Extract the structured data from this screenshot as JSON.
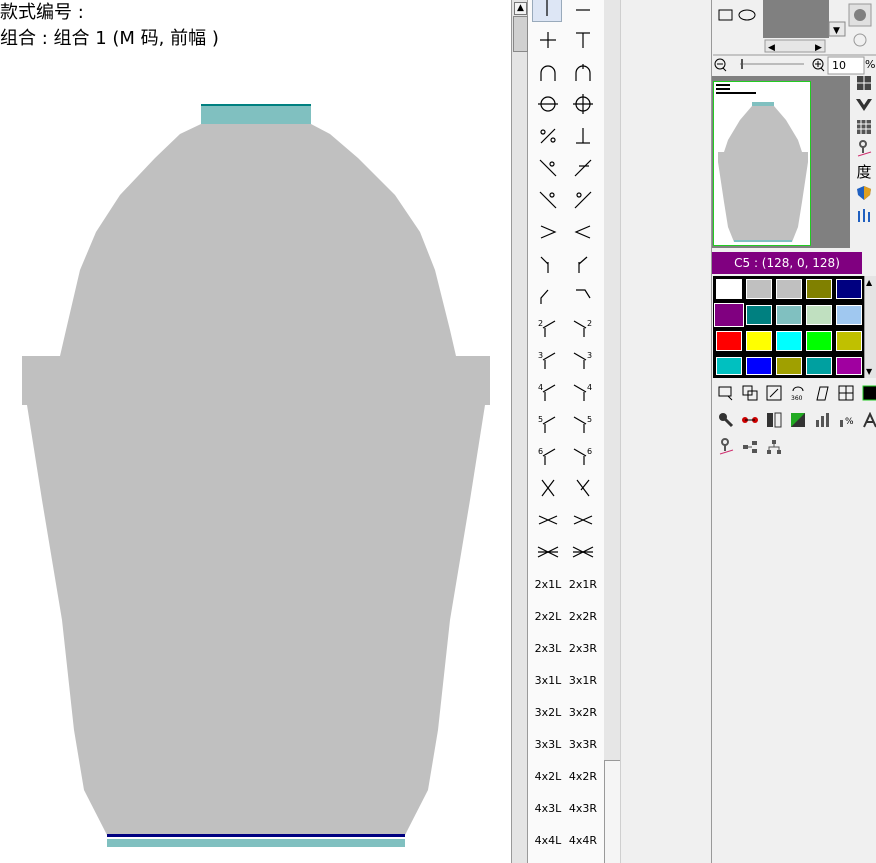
{
  "canvas": {
    "style_number_label": "款式编号 :",
    "combo_label": "组合 : 组合 1 (M 码, 前幅 )"
  },
  "symbol_palette": {
    "text_items": [
      [
        "2x1L",
        "2x1R"
      ],
      [
        "2x2L",
        "2x2R"
      ],
      [
        "2x3L",
        "2x3R"
      ],
      [
        "3x1L",
        "3x1R"
      ],
      [
        "3x2L",
        "3x2R"
      ],
      [
        "3x3L",
        "3x3R"
      ],
      [
        "4x2L",
        "4x2R"
      ],
      [
        "4x3L",
        "4x3R"
      ],
      [
        "4x4L",
        "4x4R"
      ]
    ]
  },
  "right_panel": {
    "zoom_value": "10",
    "zoom_unit": "%",
    "degree_icon_char": "度",
    "current_color_label": "C5 : (128, 0, 128)",
    "current_color": "#800080",
    "palette_colors": [
      "#ffffff",
      "#c0c0c0",
      "#c0c0c0",
      "#808000",
      "#000080",
      "#800080",
      "#008080",
      "#80c0c0",
      "#c0e0c0",
      "#a0c8f0",
      "#ff0000",
      "#ffff00",
      "#00ffff",
      "#00ff00",
      "#c0c000",
      "#00c0c0",
      "#0000ff",
      "#a0a000",
      "#00a0a0",
      "#a000a0"
    ]
  },
  "colors": {
    "garment_body": "#c0c0c0",
    "neck_rib": "#80c0c0",
    "hem_stripe": "#000080",
    "preview_border": "#22cc22"
  }
}
